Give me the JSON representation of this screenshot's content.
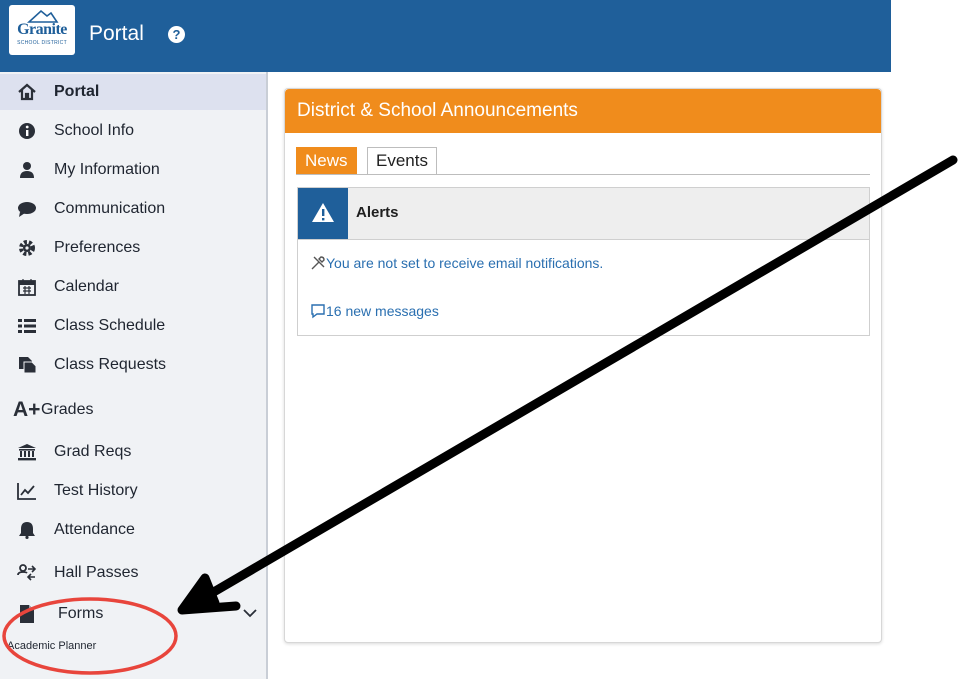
{
  "header": {
    "logo": {
      "name": "Granite",
      "sub": "SCHOOL DISTRICT"
    },
    "title": "Portal",
    "help_icon": "question-circle-icon"
  },
  "sidebar": {
    "items": [
      {
        "label": "Portal",
        "icon": "home-icon",
        "active": true
      },
      {
        "label": "School Info",
        "icon": "info-circle-icon"
      },
      {
        "label": "My Information",
        "icon": "user-icon"
      },
      {
        "label": "Communication",
        "icon": "chat-bubble-icon"
      },
      {
        "label": "Preferences",
        "icon": "gear-icon"
      },
      {
        "label": "Calendar",
        "icon": "calendar-icon"
      },
      {
        "label": "Class Schedule",
        "icon": "list-icon"
      },
      {
        "label": "Class Requests",
        "icon": "document-icon"
      },
      {
        "label": "Grades",
        "icon": "a-plus-icon"
      },
      {
        "label": "Grad Reqs",
        "icon": "building-icon"
      },
      {
        "label": "Test History",
        "icon": "line-chart-icon"
      },
      {
        "label": "Attendance",
        "icon": "bell-icon"
      },
      {
        "label": "Hall Passes",
        "icon": "user-transfer-icon"
      },
      {
        "label": "Forms",
        "icon": "file-icon",
        "expanded": true
      }
    ],
    "subitems": [
      {
        "label": "Academic Planner"
      }
    ]
  },
  "main": {
    "panel_title": "District & School Announcements",
    "tabs": [
      {
        "label": "News",
        "active": true
      },
      {
        "label": "Events"
      }
    ],
    "alerts": {
      "title": "Alerts",
      "lines": [
        {
          "text": "You are not set to receive email notifications.",
          "icon": "tools-icon"
        },
        {
          "text": "16 new messages",
          "icon": "message-icon"
        }
      ]
    }
  },
  "colors": {
    "header": "#1f5f9a",
    "accent_orange": "#f08c1c",
    "link": "#2a6fb0",
    "sidebar_bg": "#f0f2f5",
    "active_item": "#dde1ef",
    "annotation_red": "#e8453c"
  }
}
